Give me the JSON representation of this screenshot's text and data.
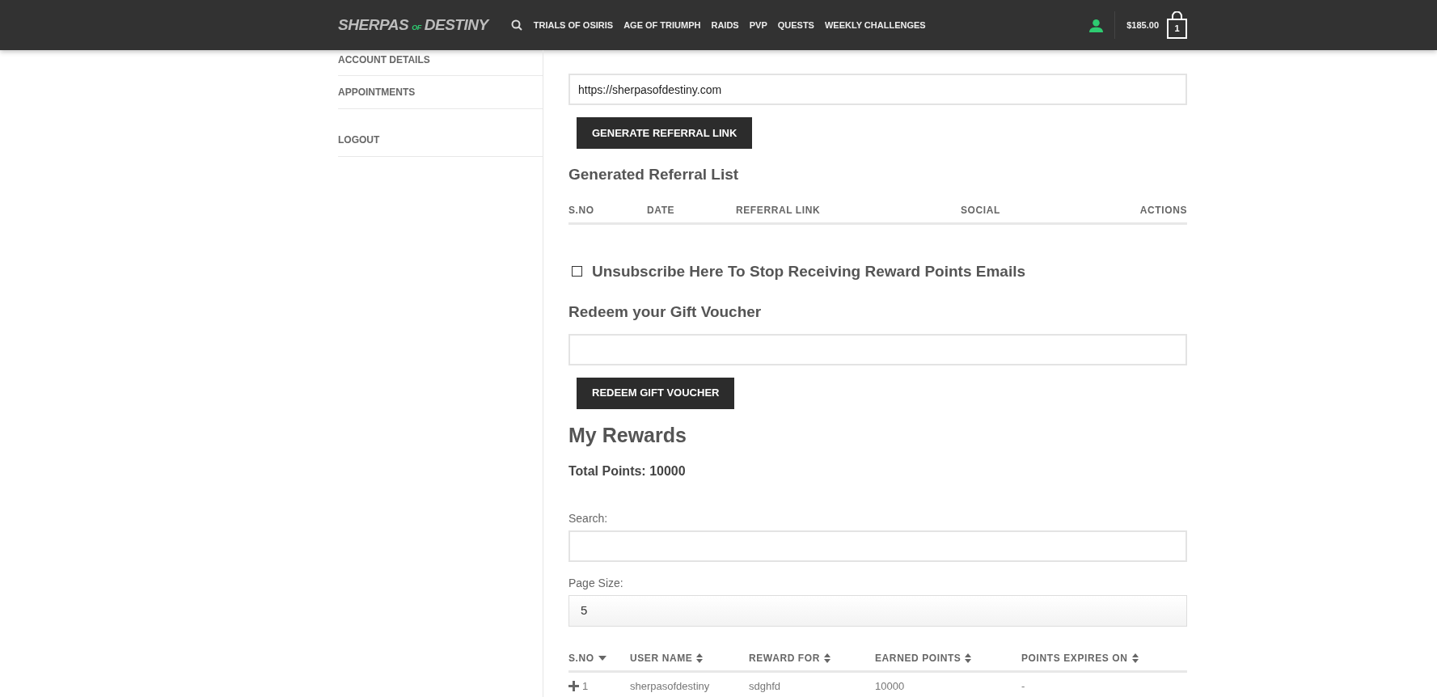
{
  "header": {
    "logo": {
      "main": "SHERPAS",
      "small": "OF",
      "end": "DESTINY"
    },
    "nav": [
      "TRIALS OF OSIRIS",
      "AGE OF TRIUMPH",
      "RAIDS",
      "PVP",
      "QUESTS",
      "WEEKLY CHALLENGES"
    ],
    "cart_total": "$185.00",
    "cart_count": "1"
  },
  "sidebar": {
    "items": [
      {
        "label": "ACCOUNT DETAILS"
      },
      {
        "label": "APPOINTMENTS"
      },
      {
        "label": "LOGOUT"
      }
    ]
  },
  "referral": {
    "link_value": "https://sherpasofdestiny.com",
    "button": "GENERATE REFERRAL LINK",
    "list_title": "Generated Referral List",
    "columns": [
      "S.NO",
      "DATE",
      "REFERRAL LINK",
      "SOCIAL",
      "ACTIONS"
    ]
  },
  "unsubscribe": {
    "label": "Unsubscribe Here To Stop Receiving Reward Points Emails",
    "checked": false
  },
  "voucher": {
    "title": "Redeem your Gift Voucher",
    "button": "REDEEM GIFT VOUCHER"
  },
  "rewards": {
    "title": "My Rewards",
    "total": "Total Points: 10000",
    "search_label": "Search:",
    "page_size_label": "Page Size:",
    "page_size": "5",
    "columns": [
      {
        "label": "S.NO",
        "sorted": true
      },
      {
        "label": "USER NAME",
        "sorted": false
      },
      {
        "label": "REWARD FOR",
        "sorted": false
      },
      {
        "label": "EARNED POINTS",
        "sorted": false
      },
      {
        "label": "POINTS EXPIRES ON",
        "sorted": false
      }
    ],
    "rows": [
      {
        "cells": [
          "1",
          "sherpasofdestiny",
          "sdghfd",
          "10000",
          "-"
        ],
        "expanded": false
      }
    ]
  }
}
